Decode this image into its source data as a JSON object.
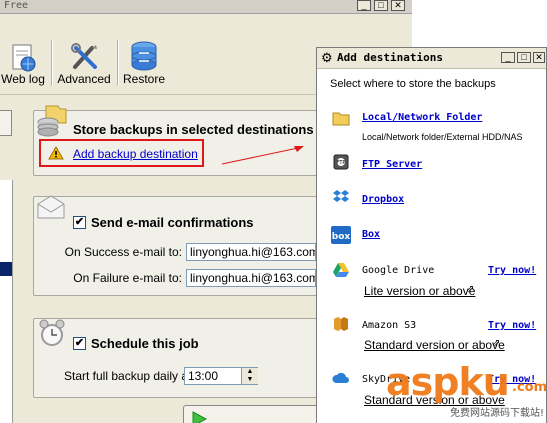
{
  "app": {
    "title": "Free",
    "toolbar": [
      {
        "label": "Web log",
        "icon": "web-log-icon"
      },
      {
        "label": "Advanced",
        "icon": "tools-icon"
      },
      {
        "label": "Restore",
        "icon": "restore-database-icon"
      }
    ],
    "destinations": {
      "title": "Store backups in selected destinations",
      "add_link": "Add backup destination"
    },
    "email": {
      "title": "Send e-mail confirmations",
      "checked": true,
      "success_label": "On Success e-mail to:",
      "success_value": "linyonghua.hi@163.com",
      "failure_label": "On Failure e-mail to:",
      "failure_value": "linyonghua.hi@163.com"
    },
    "schedule": {
      "title": "Schedule this job",
      "checked": true,
      "start_label": "Start full backup daily at:",
      "time_value": "13:00"
    }
  },
  "dialog": {
    "title": "Add destinations",
    "prompt": "Select where to store the backups",
    "items": [
      {
        "name": "Local/Network Folder",
        "desc": "Local/Network folder/External HDD/NAS",
        "icon": "folder-icon"
      },
      {
        "name": "FTP Server",
        "icon": "ftp-server-icon"
      },
      {
        "name": "Dropbox",
        "icon": "dropbox-icon"
      },
      {
        "name": "Box",
        "icon": "box-icon"
      },
      {
        "name": "Google Drive",
        "try": "Try now!",
        "version": "Lite version or above",
        "icon": "google-drive-icon"
      },
      {
        "name": "Amazon S3",
        "try": "Try now!",
        "version": "Standard version or above",
        "icon": "amazon-s3-icon"
      },
      {
        "name": "SkyDrive",
        "try": "Try now!",
        "version": "Standard version or above",
        "icon": "skydrive-icon"
      }
    ]
  },
  "watermark": {
    "text_main": "aspku",
    "text_tld": ".com",
    "subtitle": "免费网站源码下载站!"
  },
  "colors": {
    "highlight": "#e01818",
    "link": "#0000cc",
    "watermark_orange": "#f07a18",
    "window_bg": "#ece9d8"
  }
}
